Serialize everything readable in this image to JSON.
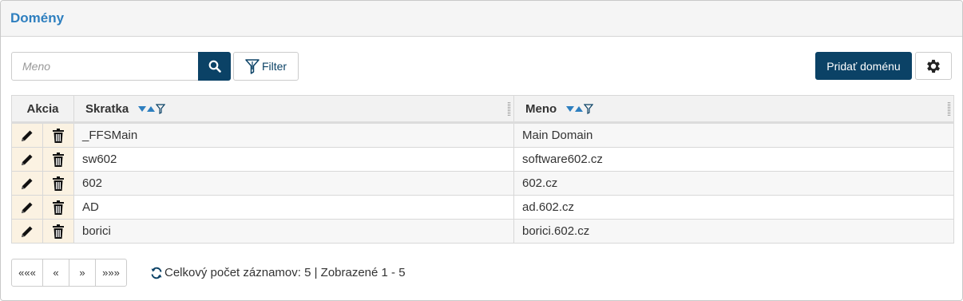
{
  "panel": {
    "title": "Domény"
  },
  "toolbar": {
    "search_placeholder": "Meno",
    "search_value": "",
    "filter_label": "Filter",
    "add_label": "Pridať doménu"
  },
  "table": {
    "columns": {
      "akcia": "Akcia",
      "skratka": "Skratka",
      "meno": "Meno"
    },
    "rows": [
      {
        "skratka": "_FFSMain",
        "meno": "Main Domain"
      },
      {
        "skratka": "sw602",
        "meno": "software602.cz"
      },
      {
        "skratka": "602",
        "meno": "602.cz"
      },
      {
        "skratka": "AD",
        "meno": "ad.602.cz"
      },
      {
        "skratka": "borici",
        "meno": "borici.602.cz"
      }
    ]
  },
  "pager": {
    "first": "«««",
    "prev": "«",
    "next": "»",
    "last": "»»»"
  },
  "status": {
    "text": "Celkový počet záznamov: 5 | Zobrazené 1 - 5"
  },
  "colors": {
    "primary": "#0b4266",
    "title": "#2e7fbf",
    "action_bg": "#fbf2e2",
    "sort_arrow": "#2e7fbf"
  },
  "icons": [
    "search-icon",
    "filter-icon",
    "gear-icon",
    "pencil-icon",
    "trash-icon",
    "sort-desc-icon",
    "sort-asc-icon",
    "refresh-icon"
  ]
}
